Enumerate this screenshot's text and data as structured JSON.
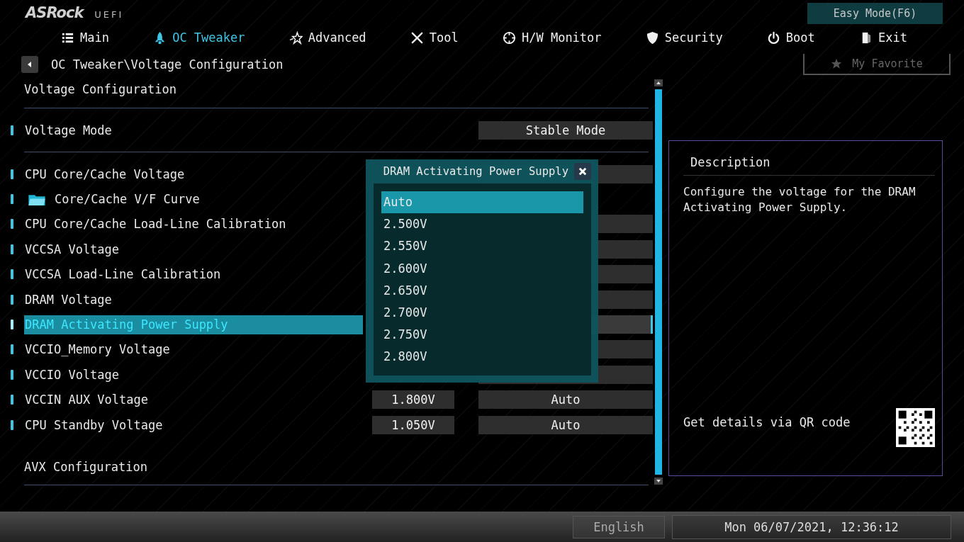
{
  "logo": {
    "brand": "ASRock",
    "suffix": "UEFI"
  },
  "easy_mode_button": "Easy Mode(F6)",
  "tabs": [
    {
      "label": "Main",
      "selected": false
    },
    {
      "label": "OC Tweaker",
      "selected": true
    },
    {
      "label": "Advanced",
      "selected": false
    },
    {
      "label": "Tool",
      "selected": false
    },
    {
      "label": "H/W Monitor",
      "selected": false
    },
    {
      "label": "Security",
      "selected": false
    },
    {
      "label": "Boot",
      "selected": false
    },
    {
      "label": "Exit",
      "selected": false
    }
  ],
  "breadcrumb": "OC Tweaker\\Voltage Configuration",
  "favorite_button": "My Favorite",
  "section_title": "Voltage Configuration",
  "rows": [
    {
      "kind": "mode",
      "label": "Voltage Mode",
      "value": "Stable Mode",
      "selected": false
    },
    {
      "kind": "setting",
      "label": "CPU Core/Cache Voltage",
      "selected": false
    },
    {
      "kind": "folder",
      "label": "Core/Cache V/F Curve",
      "selected": false
    },
    {
      "kind": "setting",
      "label": "CPU Core/Cache Load-Line Calibration",
      "selected": false
    },
    {
      "kind": "setting",
      "label": "VCCSA Voltage",
      "selected": false
    },
    {
      "kind": "setting",
      "label": "VCCSA Load-Line Calibration",
      "selected": false
    },
    {
      "kind": "setting",
      "label": "DRAM Voltage",
      "selected": false
    },
    {
      "kind": "setting",
      "label": "DRAM Activating Power Supply",
      "selected": true
    },
    {
      "kind": "setting",
      "label": "VCCIO_Memory Voltage",
      "selected": false
    },
    {
      "kind": "setting",
      "label": "VCCIO Voltage",
      "selected": false
    },
    {
      "kind": "setting",
      "label": "VCCIN AUX Voltage",
      "value": "1.800V",
      "option": "Auto",
      "selected": false
    },
    {
      "kind": "setting",
      "label": "CPU Standby Voltage",
      "value": "1.050V",
      "option": "Auto",
      "selected": false
    }
  ],
  "footer_item": "AVX Configuration",
  "popup": {
    "title": "DRAM Activating Power Supply",
    "options": [
      {
        "label": "Auto",
        "selected": true
      },
      {
        "label": "2.500V",
        "selected": false
      },
      {
        "label": "2.550V",
        "selected": false
      },
      {
        "label": "2.600V",
        "selected": false
      },
      {
        "label": "2.650V",
        "selected": false
      },
      {
        "label": "2.700V",
        "selected": false
      },
      {
        "label": "2.750V",
        "selected": false
      },
      {
        "label": "2.800V",
        "selected": false
      }
    ]
  },
  "description": {
    "title": "Description",
    "text": "Configure the voltage for the DRAM Activating Power Supply.",
    "qr_hint": "Get details via QR code"
  },
  "status_bar": {
    "language": "English",
    "datetime": "Mon 06/07/2021, 12:36:12"
  }
}
